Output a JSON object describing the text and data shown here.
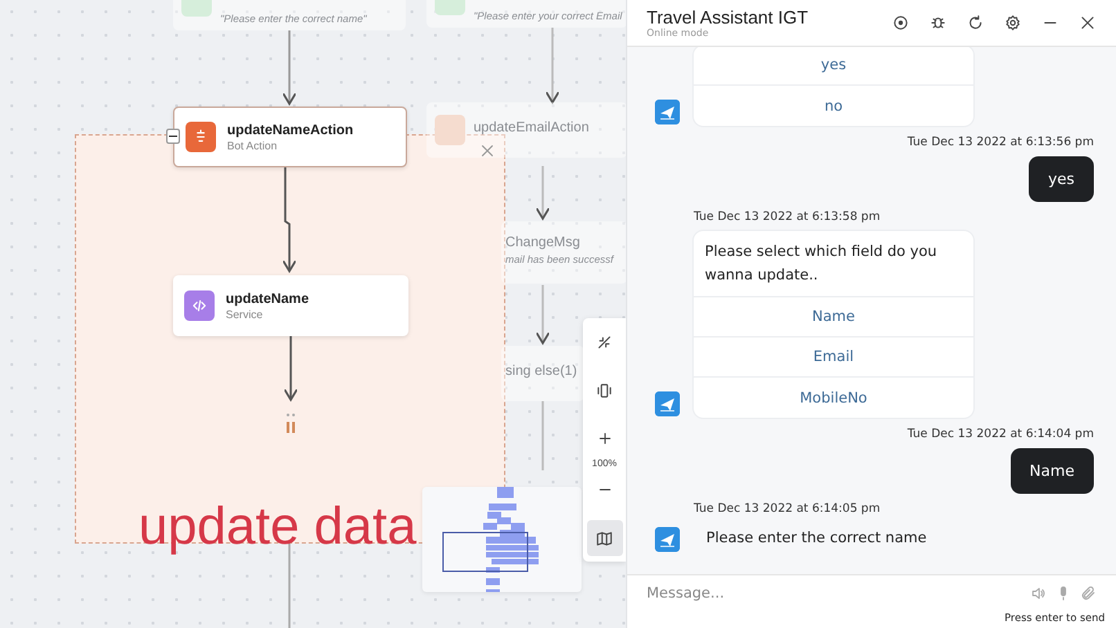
{
  "canvas": {
    "background_nodes": [
      {
        "subtitle": "\"Please enter the correct name\"",
        "color": "#d6eedb"
      },
      {
        "subtitle": "\"Please enter your correct Email",
        "color": "#d6eedb"
      },
      {
        "title": "updateEmailAction",
        "color": "#f5dccf"
      },
      {
        "title": "ChangeMsg",
        "subtitle": "mail has been successf"
      },
      {
        "title": "sing else(1)"
      }
    ],
    "group": {
      "label": "update data",
      "collapsed": false
    },
    "nodes": [
      {
        "title": "updateNameAction",
        "subtitle": "Bot Action",
        "kind": "bot_action",
        "selected": true
      },
      {
        "title": "updateName",
        "subtitle": "Service",
        "kind": "service",
        "selected": false
      }
    ],
    "zoom_controls": {
      "zoom": "100%",
      "minimap_selected": true
    }
  },
  "chat": {
    "title": "Travel Assistant IGT",
    "status": "Online mode",
    "messages": [
      {
        "kind": "bot",
        "options": [
          "yes",
          "no"
        ]
      },
      {
        "kind": "user",
        "timestamp": "Tue Dec 13 2022 at 6:13:56 pm",
        "text": "yes"
      },
      {
        "kind": "bot",
        "timestamp": "Tue Dec 13 2022 at 6:13:58 pm",
        "text": "Please select which field do you wanna update..",
        "options": [
          "Name",
          "Email",
          "MobileNo"
        ]
      },
      {
        "kind": "user",
        "timestamp": "Tue Dec 13 2022 at 6:14:04 pm",
        "text": "Name"
      },
      {
        "kind": "bot_plain",
        "timestamp": "Tue Dec 13 2022 at 6:14:05 pm",
        "text": "Please enter the correct name"
      }
    ],
    "composer": {
      "placeholder": "Message...",
      "hint": "Press enter to send"
    }
  }
}
